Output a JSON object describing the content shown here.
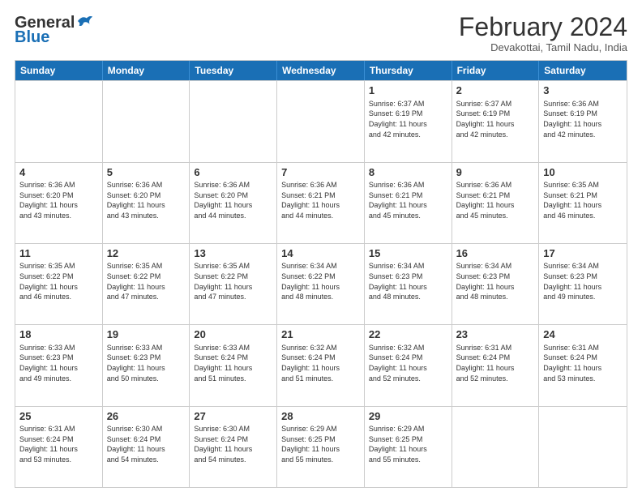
{
  "logo": {
    "general": "General",
    "blue": "Blue"
  },
  "title": "February 2024",
  "subtitle": "Devakottai, Tamil Nadu, India",
  "days": [
    "Sunday",
    "Monday",
    "Tuesday",
    "Wednesday",
    "Thursday",
    "Friday",
    "Saturday"
  ],
  "weeks": [
    [
      {
        "day": "",
        "info": ""
      },
      {
        "day": "",
        "info": ""
      },
      {
        "day": "",
        "info": ""
      },
      {
        "day": "",
        "info": ""
      },
      {
        "day": "1",
        "info": "Sunrise: 6:37 AM\nSunset: 6:19 PM\nDaylight: 11 hours\nand 42 minutes."
      },
      {
        "day": "2",
        "info": "Sunrise: 6:37 AM\nSunset: 6:19 PM\nDaylight: 11 hours\nand 42 minutes."
      },
      {
        "day": "3",
        "info": "Sunrise: 6:36 AM\nSunset: 6:19 PM\nDaylight: 11 hours\nand 42 minutes."
      }
    ],
    [
      {
        "day": "4",
        "info": "Sunrise: 6:36 AM\nSunset: 6:20 PM\nDaylight: 11 hours\nand 43 minutes."
      },
      {
        "day": "5",
        "info": "Sunrise: 6:36 AM\nSunset: 6:20 PM\nDaylight: 11 hours\nand 43 minutes."
      },
      {
        "day": "6",
        "info": "Sunrise: 6:36 AM\nSunset: 6:20 PM\nDaylight: 11 hours\nand 44 minutes."
      },
      {
        "day": "7",
        "info": "Sunrise: 6:36 AM\nSunset: 6:21 PM\nDaylight: 11 hours\nand 44 minutes."
      },
      {
        "day": "8",
        "info": "Sunrise: 6:36 AM\nSunset: 6:21 PM\nDaylight: 11 hours\nand 45 minutes."
      },
      {
        "day": "9",
        "info": "Sunrise: 6:36 AM\nSunset: 6:21 PM\nDaylight: 11 hours\nand 45 minutes."
      },
      {
        "day": "10",
        "info": "Sunrise: 6:35 AM\nSunset: 6:21 PM\nDaylight: 11 hours\nand 46 minutes."
      }
    ],
    [
      {
        "day": "11",
        "info": "Sunrise: 6:35 AM\nSunset: 6:22 PM\nDaylight: 11 hours\nand 46 minutes."
      },
      {
        "day": "12",
        "info": "Sunrise: 6:35 AM\nSunset: 6:22 PM\nDaylight: 11 hours\nand 47 minutes."
      },
      {
        "day": "13",
        "info": "Sunrise: 6:35 AM\nSunset: 6:22 PM\nDaylight: 11 hours\nand 47 minutes."
      },
      {
        "day": "14",
        "info": "Sunrise: 6:34 AM\nSunset: 6:22 PM\nDaylight: 11 hours\nand 48 minutes."
      },
      {
        "day": "15",
        "info": "Sunrise: 6:34 AM\nSunset: 6:23 PM\nDaylight: 11 hours\nand 48 minutes."
      },
      {
        "day": "16",
        "info": "Sunrise: 6:34 AM\nSunset: 6:23 PM\nDaylight: 11 hours\nand 48 minutes."
      },
      {
        "day": "17",
        "info": "Sunrise: 6:34 AM\nSunset: 6:23 PM\nDaylight: 11 hours\nand 49 minutes."
      }
    ],
    [
      {
        "day": "18",
        "info": "Sunrise: 6:33 AM\nSunset: 6:23 PM\nDaylight: 11 hours\nand 49 minutes."
      },
      {
        "day": "19",
        "info": "Sunrise: 6:33 AM\nSunset: 6:23 PM\nDaylight: 11 hours\nand 50 minutes."
      },
      {
        "day": "20",
        "info": "Sunrise: 6:33 AM\nSunset: 6:24 PM\nDaylight: 11 hours\nand 51 minutes."
      },
      {
        "day": "21",
        "info": "Sunrise: 6:32 AM\nSunset: 6:24 PM\nDaylight: 11 hours\nand 51 minutes."
      },
      {
        "day": "22",
        "info": "Sunrise: 6:32 AM\nSunset: 6:24 PM\nDaylight: 11 hours\nand 52 minutes."
      },
      {
        "day": "23",
        "info": "Sunrise: 6:31 AM\nSunset: 6:24 PM\nDaylight: 11 hours\nand 52 minutes."
      },
      {
        "day": "24",
        "info": "Sunrise: 6:31 AM\nSunset: 6:24 PM\nDaylight: 11 hours\nand 53 minutes."
      }
    ],
    [
      {
        "day": "25",
        "info": "Sunrise: 6:31 AM\nSunset: 6:24 PM\nDaylight: 11 hours\nand 53 minutes."
      },
      {
        "day": "26",
        "info": "Sunrise: 6:30 AM\nSunset: 6:24 PM\nDaylight: 11 hours\nand 54 minutes."
      },
      {
        "day": "27",
        "info": "Sunrise: 6:30 AM\nSunset: 6:24 PM\nDaylight: 11 hours\nand 54 minutes."
      },
      {
        "day": "28",
        "info": "Sunrise: 6:29 AM\nSunset: 6:25 PM\nDaylight: 11 hours\nand 55 minutes."
      },
      {
        "day": "29",
        "info": "Sunrise: 6:29 AM\nSunset: 6:25 PM\nDaylight: 11 hours\nand 55 minutes."
      },
      {
        "day": "",
        "info": ""
      },
      {
        "day": "",
        "info": ""
      }
    ]
  ]
}
